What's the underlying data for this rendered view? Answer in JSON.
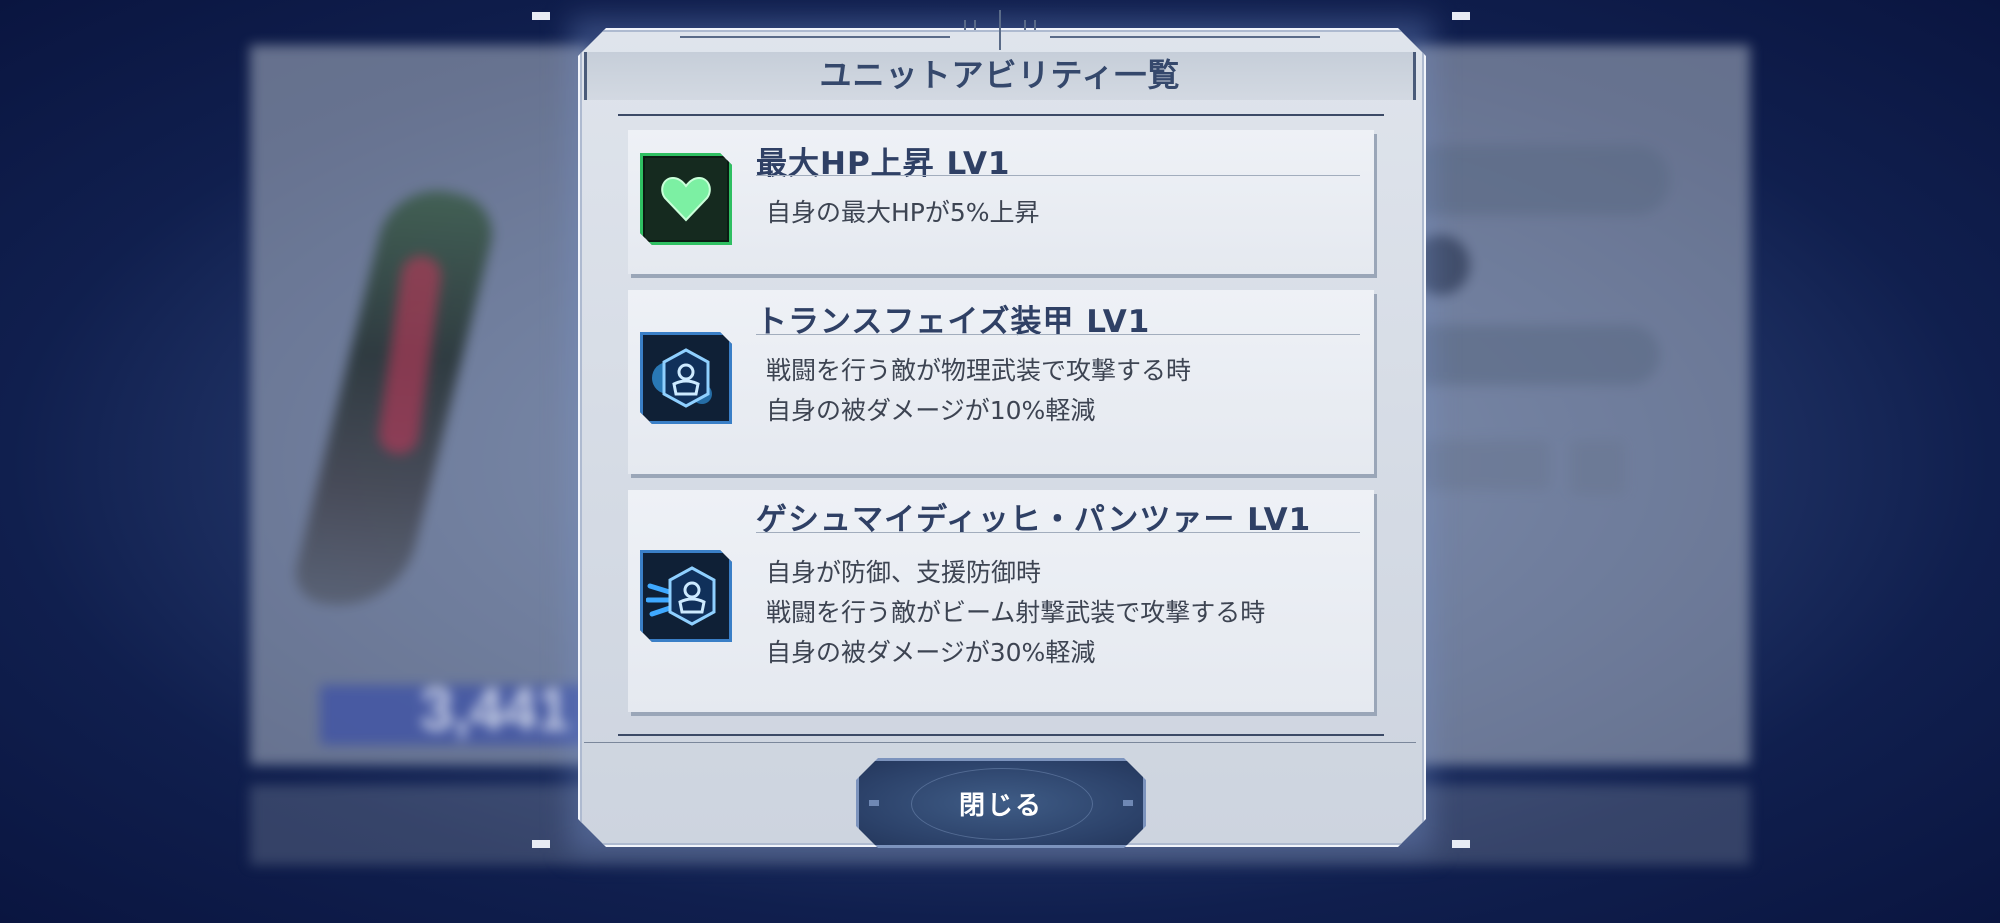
{
  "background": {
    "blurred_number": "3,441"
  },
  "modal": {
    "title": "ユニットアビリティ一覧",
    "abilities": [
      {
        "title": "最大HP上昇 LV1",
        "icon": "heart-icon",
        "icon_color": "#2fbf62",
        "description": [
          "自身の最大HPが5%上昇"
        ]
      },
      {
        "title": "トランスフェイズ装甲 LV1",
        "icon": "armor-shield-icon",
        "icon_color": "#3a7fc7",
        "description": [
          "戦闘を行う敵が物理武装で攻撃する時",
          "自身の被ダメージが10%軽減"
        ]
      },
      {
        "title": "ゲシュマイディッヒ・パンツァー LV1",
        "icon": "beam-deflect-shield-icon",
        "icon_color": "#3a7fc7",
        "description": [
          "自身が防御、支援防御時",
          "戦闘を行う敵がビーム射撃武装で攻撃する時",
          "自身の被ダメージが30%軽減"
        ]
      }
    ],
    "close_label": "閉じる"
  }
}
